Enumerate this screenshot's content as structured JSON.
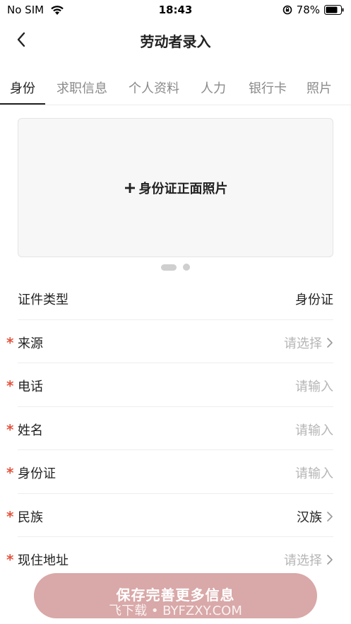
{
  "status_bar": {
    "carrier": "No SIM",
    "time": "18:43",
    "battery": "78%"
  },
  "nav": {
    "title": "劳动者录入"
  },
  "tabs": [
    {
      "label": "身份",
      "active": true
    },
    {
      "label": "求职信息",
      "active": false
    },
    {
      "label": "个人资料",
      "active": false
    },
    {
      "label": "人力",
      "active": false
    },
    {
      "label": "银行卡",
      "active": false
    },
    {
      "label": "照片",
      "active": false
    }
  ],
  "photo_card": {
    "label": "身份证正面照片",
    "icon": "plus-icon"
  },
  "pager": {
    "pages": 2,
    "current": 1
  },
  "form": {
    "rows": [
      {
        "label": "证件类型",
        "required": false,
        "value": "身份证",
        "placeholder": false,
        "chevron": false
      },
      {
        "label": "来源",
        "required": true,
        "value": "请选择",
        "placeholder": true,
        "chevron": true
      },
      {
        "label": "电话",
        "required": true,
        "value": "请输入",
        "placeholder": true,
        "chevron": false
      },
      {
        "label": "姓名",
        "required": true,
        "value": "请输入",
        "placeholder": true,
        "chevron": false
      },
      {
        "label": "身份证",
        "required": true,
        "value": "请输入",
        "placeholder": true,
        "chevron": false
      },
      {
        "label": "民族",
        "required": true,
        "value": "汉族",
        "placeholder": false,
        "chevron": true
      },
      {
        "label": "现住地址",
        "required": true,
        "value": "请选择",
        "placeholder": true,
        "chevron": true
      }
    ]
  },
  "save_button": {
    "label": "保存完善更多信息",
    "color": "#d9a8a8"
  },
  "watermark": {
    "text": "飞下载 • BYFZXY.COM"
  },
  "colors": {
    "required_star": "#e4543e",
    "placeholder": "#b5b5b5"
  }
}
